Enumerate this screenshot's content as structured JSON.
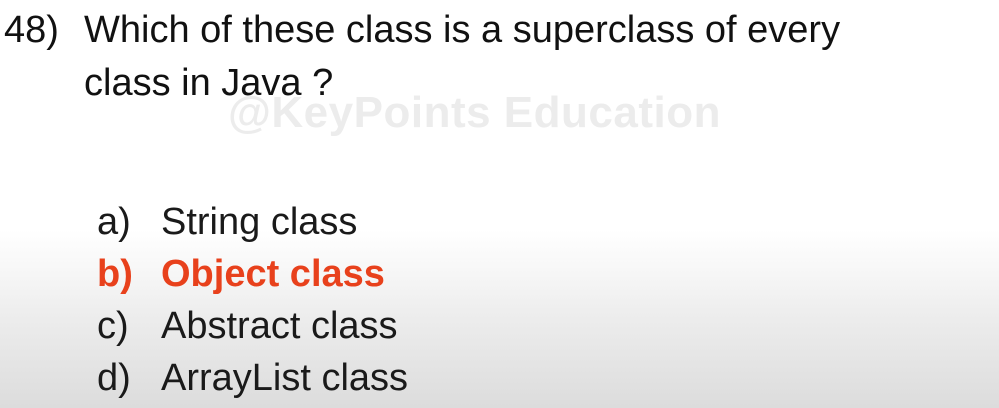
{
  "question": {
    "number": "48)",
    "line1": "Which of these class is a superclass of every",
    "line2": "class in Java ?"
  },
  "watermark": "@KeyPoints Education",
  "options": [
    {
      "letter": "a)",
      "text": "String class",
      "correct": false
    },
    {
      "letter": "b)",
      "text": "Object class",
      "correct": true
    },
    {
      "letter": "c)",
      "text": "Abstract class",
      "correct": false
    },
    {
      "letter": "d)",
      "text": "ArrayList class",
      "correct": false
    }
  ],
  "colors": {
    "correct_answer": "#e8411c",
    "text": "#111111",
    "watermark": "#ececec"
  }
}
